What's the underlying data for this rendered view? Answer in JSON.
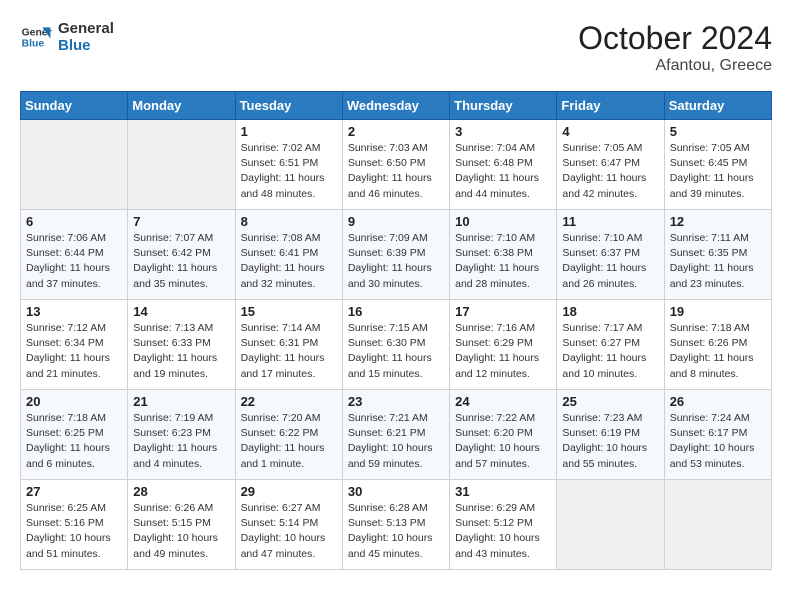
{
  "logo": {
    "line1": "General",
    "line2": "Blue"
  },
  "title": "October 2024",
  "subtitle": "Afantou, Greece",
  "header_days": [
    "Sunday",
    "Monday",
    "Tuesday",
    "Wednesday",
    "Thursday",
    "Friday",
    "Saturday"
  ],
  "weeks": [
    [
      {
        "day": "",
        "info": ""
      },
      {
        "day": "",
        "info": ""
      },
      {
        "day": "1",
        "info": "Sunrise: 7:02 AM\nSunset: 6:51 PM\nDaylight: 11 hours\nand 48 minutes."
      },
      {
        "day": "2",
        "info": "Sunrise: 7:03 AM\nSunset: 6:50 PM\nDaylight: 11 hours\nand 46 minutes."
      },
      {
        "day": "3",
        "info": "Sunrise: 7:04 AM\nSunset: 6:48 PM\nDaylight: 11 hours\nand 44 minutes."
      },
      {
        "day": "4",
        "info": "Sunrise: 7:05 AM\nSunset: 6:47 PM\nDaylight: 11 hours\nand 42 minutes."
      },
      {
        "day": "5",
        "info": "Sunrise: 7:05 AM\nSunset: 6:45 PM\nDaylight: 11 hours\nand 39 minutes."
      }
    ],
    [
      {
        "day": "6",
        "info": "Sunrise: 7:06 AM\nSunset: 6:44 PM\nDaylight: 11 hours\nand 37 minutes."
      },
      {
        "day": "7",
        "info": "Sunrise: 7:07 AM\nSunset: 6:42 PM\nDaylight: 11 hours\nand 35 minutes."
      },
      {
        "day": "8",
        "info": "Sunrise: 7:08 AM\nSunset: 6:41 PM\nDaylight: 11 hours\nand 32 minutes."
      },
      {
        "day": "9",
        "info": "Sunrise: 7:09 AM\nSunset: 6:39 PM\nDaylight: 11 hours\nand 30 minutes."
      },
      {
        "day": "10",
        "info": "Sunrise: 7:10 AM\nSunset: 6:38 PM\nDaylight: 11 hours\nand 28 minutes."
      },
      {
        "day": "11",
        "info": "Sunrise: 7:10 AM\nSunset: 6:37 PM\nDaylight: 11 hours\nand 26 minutes."
      },
      {
        "day": "12",
        "info": "Sunrise: 7:11 AM\nSunset: 6:35 PM\nDaylight: 11 hours\nand 23 minutes."
      }
    ],
    [
      {
        "day": "13",
        "info": "Sunrise: 7:12 AM\nSunset: 6:34 PM\nDaylight: 11 hours\nand 21 minutes."
      },
      {
        "day": "14",
        "info": "Sunrise: 7:13 AM\nSunset: 6:33 PM\nDaylight: 11 hours\nand 19 minutes."
      },
      {
        "day": "15",
        "info": "Sunrise: 7:14 AM\nSunset: 6:31 PM\nDaylight: 11 hours\nand 17 minutes."
      },
      {
        "day": "16",
        "info": "Sunrise: 7:15 AM\nSunset: 6:30 PM\nDaylight: 11 hours\nand 15 minutes."
      },
      {
        "day": "17",
        "info": "Sunrise: 7:16 AM\nSunset: 6:29 PM\nDaylight: 11 hours\nand 12 minutes."
      },
      {
        "day": "18",
        "info": "Sunrise: 7:17 AM\nSunset: 6:27 PM\nDaylight: 11 hours\nand 10 minutes."
      },
      {
        "day": "19",
        "info": "Sunrise: 7:18 AM\nSunset: 6:26 PM\nDaylight: 11 hours\nand 8 minutes."
      }
    ],
    [
      {
        "day": "20",
        "info": "Sunrise: 7:18 AM\nSunset: 6:25 PM\nDaylight: 11 hours\nand 6 minutes."
      },
      {
        "day": "21",
        "info": "Sunrise: 7:19 AM\nSunset: 6:23 PM\nDaylight: 11 hours\nand 4 minutes."
      },
      {
        "day": "22",
        "info": "Sunrise: 7:20 AM\nSunset: 6:22 PM\nDaylight: 11 hours\nand 1 minute."
      },
      {
        "day": "23",
        "info": "Sunrise: 7:21 AM\nSunset: 6:21 PM\nDaylight: 10 hours\nand 59 minutes."
      },
      {
        "day": "24",
        "info": "Sunrise: 7:22 AM\nSunset: 6:20 PM\nDaylight: 10 hours\nand 57 minutes."
      },
      {
        "day": "25",
        "info": "Sunrise: 7:23 AM\nSunset: 6:19 PM\nDaylight: 10 hours\nand 55 minutes."
      },
      {
        "day": "26",
        "info": "Sunrise: 7:24 AM\nSunset: 6:17 PM\nDaylight: 10 hours\nand 53 minutes."
      }
    ],
    [
      {
        "day": "27",
        "info": "Sunrise: 6:25 AM\nSunset: 5:16 PM\nDaylight: 10 hours\nand 51 minutes."
      },
      {
        "day": "28",
        "info": "Sunrise: 6:26 AM\nSunset: 5:15 PM\nDaylight: 10 hours\nand 49 minutes."
      },
      {
        "day": "29",
        "info": "Sunrise: 6:27 AM\nSunset: 5:14 PM\nDaylight: 10 hours\nand 47 minutes."
      },
      {
        "day": "30",
        "info": "Sunrise: 6:28 AM\nSunset: 5:13 PM\nDaylight: 10 hours\nand 45 minutes."
      },
      {
        "day": "31",
        "info": "Sunrise: 6:29 AM\nSunset: 5:12 PM\nDaylight: 10 hours\nand 43 minutes."
      },
      {
        "day": "",
        "info": ""
      },
      {
        "day": "",
        "info": ""
      }
    ]
  ]
}
